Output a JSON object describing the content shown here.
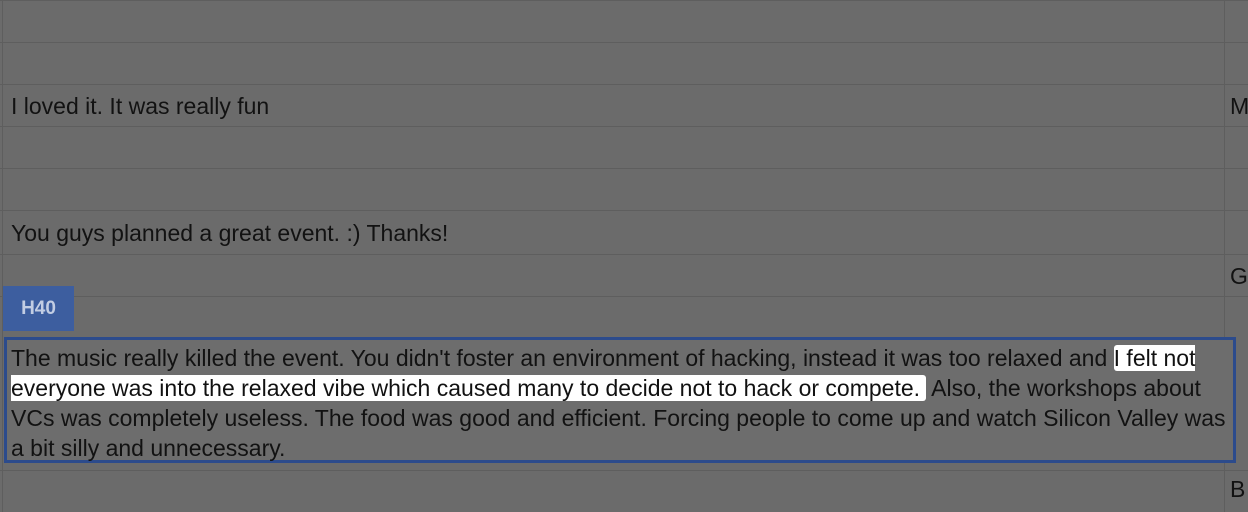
{
  "cells": {
    "row_a_text": "I loved it. It was really fun",
    "row_a_edge": "M",
    "row_b_text": "You guys planned a great event. :) Thanks!",
    "row_b_edge": "G",
    "active_name": "H40",
    "active_before": "The music really killed the event. You didn't foster an environment of hacking, instead it was too relaxed and ",
    "active_highlight": "I felt not everyone was into the relaxed vibe which caused many to decide not to hack or compete.",
    "active_after": " Also, the workshops about VCs was completely useless. The food was good and efficient. Forcing people to come up and watch Silicon Valley was a bit silly and unnecessary.",
    "row_c_edge": "B"
  },
  "colors": {
    "overlay": "#6b6b6b",
    "active_border": "#2c4b8c",
    "tag_bg": "#3d5e9f",
    "highlight": "#ffffff"
  }
}
